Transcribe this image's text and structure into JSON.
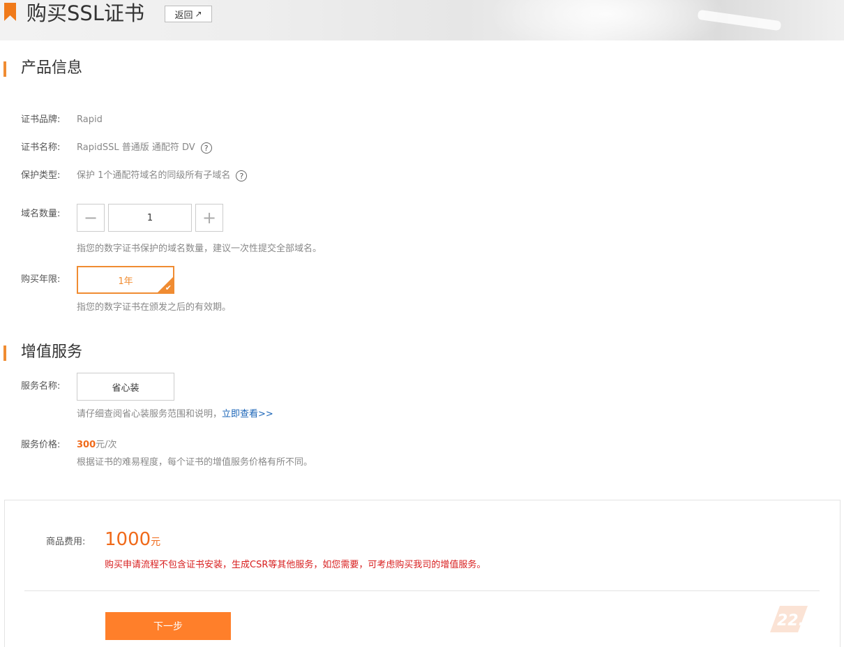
{
  "header": {
    "title": "购买SSL证书",
    "back_label": "返回",
    "back_icon": "↗"
  },
  "product_section": {
    "title": "产品信息",
    "brand_label": "证书品牌:",
    "brand_value": "Rapid",
    "name_label": "证书名称:",
    "name_value": "RapidSSL 普通版 通配符 DV",
    "protect_label": "保护类型:",
    "protect_value": "保护 1个通配符域名的同级所有子域名",
    "help_icon": "?",
    "domain_count_label": "域名数量:",
    "domain_count_value": "1",
    "minus_icon": "−",
    "plus_icon": "+",
    "domain_count_hint": "指您的数字证书保护的域名数量，建议一次性提交全部域名。",
    "years_label": "购买年限:",
    "years_option": "1年",
    "years_hint": "指您的数字证书在颁发之后的有效期。"
  },
  "value_added_section": {
    "title": "增值服务",
    "service_name_label": "服务名称:",
    "service_option": "省心装",
    "service_hint": "请仔细查阅省心装服务范围和说明，",
    "service_link": "立即查看>>",
    "service_price_label": "服务价格:",
    "service_price_value": "300",
    "service_price_unit": "元/次",
    "service_price_hint": "根据证书的难易程度，每个证书的增值服务价格有所不同。"
  },
  "summary": {
    "label": "商品费用:",
    "price": "1000",
    "unit": "元",
    "warning": "购买申请流程不包含证书安装，生成CSR等其他服务，如您需要，可考虑购买我司的增值服务。",
    "next_button": "下一步"
  },
  "watermark": {
    "text": "22.cn"
  },
  "colors": {
    "accent": "#f08c32",
    "button": "#ff7f2a",
    "price": "#f06a1a",
    "warning": "#d81e1e",
    "link": "#1a64b7"
  }
}
